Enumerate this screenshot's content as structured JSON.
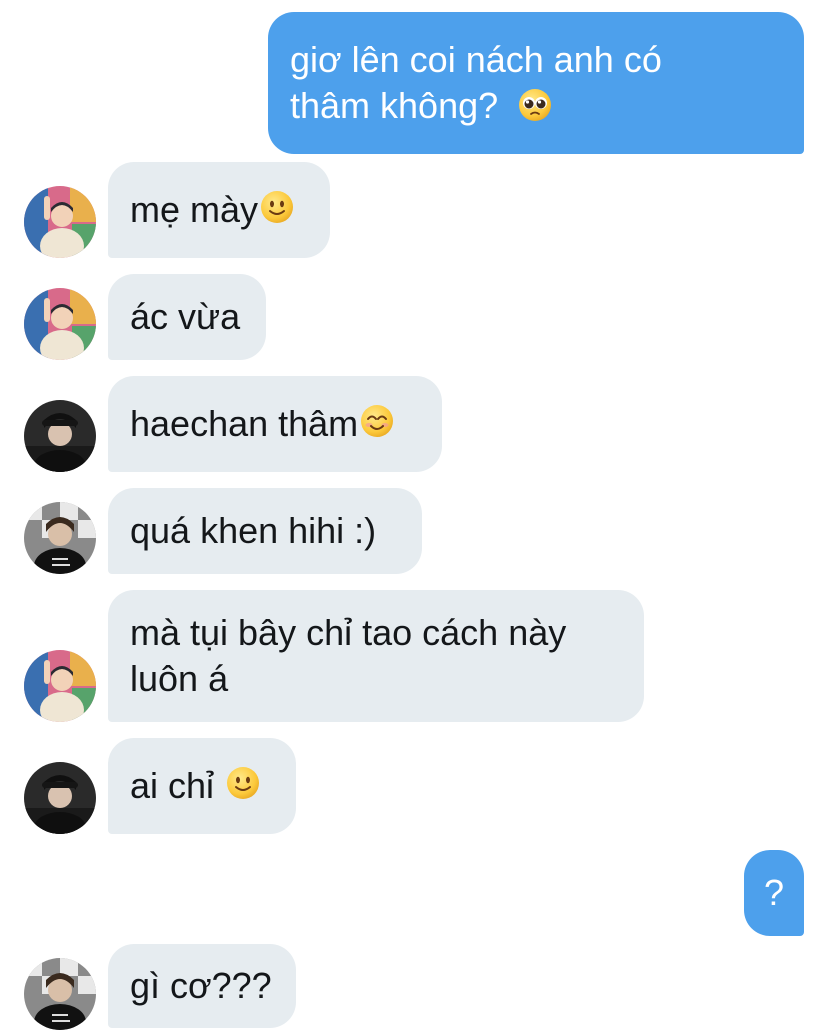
{
  "conversation": {
    "messages": [
      {
        "direction": "outgoing",
        "lines": [
          "giơ lên coi nách anh có",
          "thâm không?"
        ],
        "emoji": "pleading-face-icon"
      },
      {
        "direction": "incoming",
        "avatar": "avatar-a",
        "text": "mẹ mày",
        "emoji": "slightly-smiling-face-icon"
      },
      {
        "direction": "incoming",
        "avatar": "avatar-a",
        "text": "ác vừa"
      },
      {
        "direction": "incoming",
        "avatar": "avatar-b",
        "text": "haechan thâm",
        "emoji": "smiling-face-with-smiling-eyes-icon"
      },
      {
        "direction": "incoming",
        "avatar": "avatar-c",
        "text": "quá khen hihi :)"
      },
      {
        "direction": "incoming",
        "avatar": "avatar-a",
        "lines": [
          "mà tụi bây chỉ tao cách này",
          "luôn á"
        ]
      },
      {
        "direction": "incoming",
        "avatar": "avatar-b",
        "text": "ai chỉ ",
        "emoji": "slightly-smiling-face-icon"
      },
      {
        "direction": "outgoing",
        "text": "?"
      },
      {
        "direction": "incoming",
        "avatar": "avatar-c",
        "text": "gì cơ???"
      }
    ]
  },
  "colors": {
    "outgoing_bubble": "#4da0ec",
    "incoming_bubble": "#e6ecf0",
    "incoming_text": "#14171a",
    "outgoing_text": "#ffffff"
  }
}
